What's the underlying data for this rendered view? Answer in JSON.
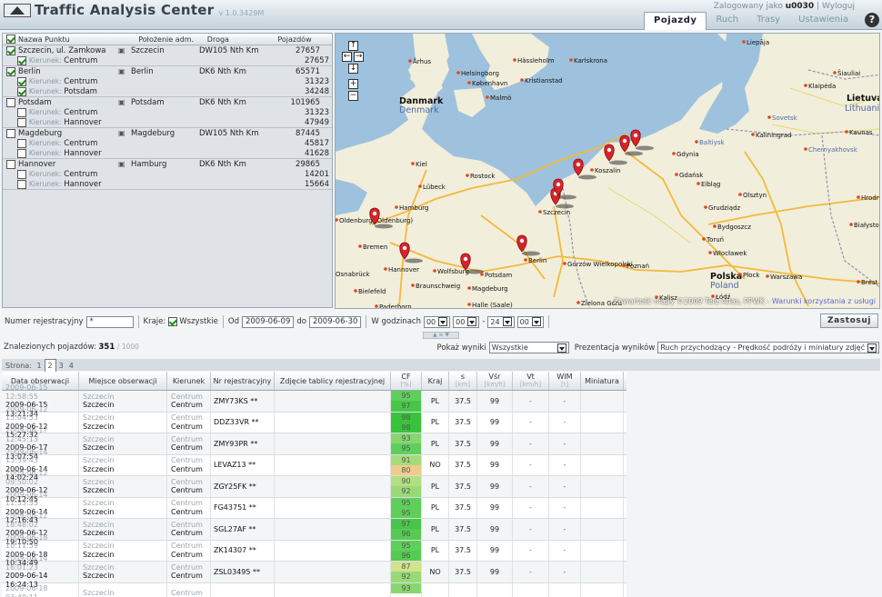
{
  "app": {
    "title": "Traffic Analysis Center",
    "version": "v 1.0.3429M"
  },
  "login": {
    "prefix": "Zalogowany jako",
    "user": "u0030",
    "sep": "|",
    "logout": "Wyloguj",
    "help": "?"
  },
  "tabs": [
    "Pojazdy",
    "Ruch",
    "Trasy",
    "Ustawienia"
  ],
  "points_table": {
    "headers": [
      "Nazwa Punktu",
      "Położenie adm.",
      "Droga",
      "Pojazdów"
    ],
    "kierunek_label": "Kierunek:",
    "groups": [
      {
        "name": "Szczecin, ul. Zamkowa",
        "checked": true,
        "adm": "Szczecin",
        "road": "DW105 Nth Km",
        "count": "27657",
        "subs": [
          {
            "dir": "Centrum",
            "checked": true,
            "count": "27657"
          }
        ]
      },
      {
        "name": "Berlin",
        "checked": true,
        "adm": "Berlin",
        "road": "DK6 Nth Km",
        "count": "65571",
        "subs": [
          {
            "dir": "Centrum",
            "checked": true,
            "count": "31323"
          },
          {
            "dir": "Potsdam",
            "checked": true,
            "count": "34248"
          }
        ]
      },
      {
        "name": "Potsdam",
        "checked": false,
        "adm": "Potsdam",
        "road": "DK6 Nth Km",
        "count": "101965",
        "subs": [
          {
            "dir": "Centrum",
            "checked": false,
            "count": "31323"
          },
          {
            "dir": "Hannover",
            "checked": false,
            "count": "47949"
          }
        ]
      },
      {
        "name": "Magdeburg",
        "checked": false,
        "adm": "Magdeburg",
        "road": "DW105 Nth Km",
        "count": "87445",
        "subs": [
          {
            "dir": "Centrum",
            "checked": false,
            "count": "45817"
          },
          {
            "dir": "Hannover",
            "checked": false,
            "count": "41628"
          }
        ]
      },
      {
        "name": "Hannover",
        "checked": false,
        "adm": "Hamburg",
        "road": "DK6 Nth Km",
        "count": "29865",
        "subs": [
          {
            "dir": "Centrum",
            "checked": false,
            "count": "14201"
          },
          {
            "dir": "Hannover",
            "checked": false,
            "count": "15664"
          }
        ]
      }
    ]
  },
  "map": {
    "cities": [
      {
        "name": "Liepāja"
      },
      {
        "name": "Århus"
      },
      {
        "name": "Hässleholm"
      },
      {
        "name": "Karlskrona"
      },
      {
        "name": "Helsingborg"
      },
      {
        "name": "København"
      },
      {
        "name": "Kristianstad"
      },
      {
        "name": "Malmö"
      },
      {
        "name": "Šiauliai"
      },
      {
        "name": "Klaipėda"
      },
      {
        "name": "Danmark"
      },
      {
        "name": "Denmark"
      },
      {
        "name": "Lietuva"
      },
      {
        "name": "Lithuania"
      },
      {
        "name": "Sovetsk"
      },
      {
        "name": "Kaunas"
      },
      {
        "name": "Kaliningrad"
      },
      {
        "name": "Baltiysk"
      },
      {
        "name": "Chernyakhovsk"
      },
      {
        "name": "Gdynia"
      },
      {
        "name": "Gdańsk"
      },
      {
        "name": "Elbląg"
      },
      {
        "name": "Olsztyn"
      },
      {
        "name": "Koszalin"
      },
      {
        "name": "Kiel"
      },
      {
        "name": "Rostock"
      },
      {
        "name": "Lübeck"
      },
      {
        "name": "Hamburg"
      },
      {
        "name": "Oldenburg (Oldenburg)"
      },
      {
        "name": "Bremen"
      },
      {
        "name": "Szczecin"
      },
      {
        "name": "Grudziądz"
      },
      {
        "name": "Bydgoszcz"
      },
      {
        "name": "Toruń"
      },
      {
        "name": "Włocławek"
      },
      {
        "name": "Gorzów Wielkopolski"
      },
      {
        "name": "Poznań"
      },
      {
        "name": "Polska"
      },
      {
        "name": "Poland"
      },
      {
        "name": "Płock"
      },
      {
        "name": "Warszawa"
      },
      {
        "name": "Hrodna"
      },
      {
        "name": "Białystok"
      },
      {
        "name": "Brest"
      },
      {
        "name": "Osnabrück"
      },
      {
        "name": "Hannover"
      },
      {
        "name": "Wolfsburg"
      },
      {
        "name": "Potsdam"
      },
      {
        "name": "Berlin"
      },
      {
        "name": "Braunschweig"
      },
      {
        "name": "Magdeburg"
      },
      {
        "name": "Bielefeld"
      },
      {
        "name": "Paderborn"
      },
      {
        "name": "Halle (Saale)"
      },
      {
        "name": "Zielona Góra"
      },
      {
        "name": "Kalisz"
      },
      {
        "name": "Łódź"
      }
    ],
    "controls": [
      "↑",
      "←",
      "→",
      "↓",
      "+",
      "−"
    ],
    "copyright": "Zawartość mapy ©2009 Tele Atlas, PPWK -",
    "terms": "Warunki korzystania z usługi"
  },
  "filter": {
    "plate_label": "Numer rejestracyjny",
    "plate_value": "*",
    "country_label": "Kraje:",
    "country_all": "Wszystkie",
    "from_label": "Od",
    "from_date": "2009-06-09",
    "to_label": "do",
    "to_date": "2009-06-30",
    "hours_label": "W godzinach",
    "h1": "00",
    "h2": "00",
    "h_sep": "-",
    "h3": "24",
    "h4": "00",
    "apply": "Zastosuj"
  },
  "results": {
    "found_label": "Znalezionych pojazdów:",
    "found": "351",
    "total": "/ 1000",
    "show_label": "Pokaż wyniki",
    "show_value": "Wszystkie",
    "present_label": "Prezentacja wyników",
    "present_value": "Ruch przychodzący - Prędkość podróży i miniatury zdjęć"
  },
  "pager": {
    "label": "Strona:",
    "pages": [
      "1",
      "2",
      "3",
      "4"
    ],
    "current": "2"
  },
  "vehicle_table": {
    "headers": [
      {
        "t": "Data obserwacji",
        "u": ""
      },
      {
        "t": "Miejsce obserwacji",
        "u": ""
      },
      {
        "t": "Kierunek",
        "u": ""
      },
      {
        "t": "Nr rejestracyjny",
        "u": ""
      },
      {
        "t": "Zdjęcie tablicy rejestracyjnej",
        "u": ""
      },
      {
        "t": "CF",
        "u": "[%]"
      },
      {
        "t": "Kraj",
        "u": ""
      },
      {
        "t": "s",
        "u": "[km]"
      },
      {
        "t": "Vśr",
        "u": "[km/h]"
      },
      {
        "t": "Vt",
        "u": "[km/h]"
      },
      {
        "t": "WIM",
        "u": "[t]"
      },
      {
        "t": "Miniatura",
        "u": ""
      }
    ],
    "rows": [
      {
        "d1": "2009-06-15  12:58:55",
        "d2": "2009-06-15  13:21:34",
        "p1": "Szczecin",
        "p2": "Szczecin",
        "k1": "Centrum",
        "k2": "Centrum",
        "nr": "ZMY73KS **",
        "cf1": "95",
        "cf2": "97",
        "c1": "#5fcf5c",
        "c2": "#49c649",
        "kraj": "PL",
        "s": "37.5",
        "v": "99",
        "vt": "-",
        "wim": "-"
      },
      {
        "d1": "2009-06-12  15:04:53",
        "d2": "2009-06-12  15:27:32",
        "p1": "Szczecin",
        "p2": "Szczecin",
        "k1": "Centrum",
        "k2": "Centrum",
        "nr": "DDZ33VR **",
        "cf1": "98",
        "cf2": "98",
        "c1": "#39c23c",
        "c2": "#39c23c",
        "kraj": "PL",
        "s": "37.5",
        "v": "99",
        "vt": "-",
        "wim": "-"
      },
      {
        "d1": "2009-06-17  12:45:13",
        "d2": "2009-06-17  13:07:54",
        "p1": "Szczecin",
        "p2": "Szczecin",
        "k1": "Centrum",
        "k2": "Centrum",
        "nr": "ZMY93PR **",
        "cf1": "93",
        "cf2": "95",
        "c1": "#87d66f",
        "c2": "#5fcf5c",
        "kraj": "PL",
        "s": "37.5",
        "v": "99",
        "vt": "-",
        "wim": "-"
      },
      {
        "d1": "2009-06-14  13:39:43",
        "d2": "2009-06-14  14:02:24",
        "p1": "Szczecin",
        "p2": "Szczecin",
        "k1": "Centrum",
        "k2": "Centrum",
        "nr": "LEVAZ13 **",
        "cf1": "91",
        "cf2": "80",
        "c1": "#a5dc7b",
        "c2": "#f0cc8a",
        "kraj": "NO",
        "s": "37.5",
        "v": "99",
        "vt": "-",
        "wim": "-"
      },
      {
        "d1": "2009-06-12  09:50:02",
        "d2": "2009-06-12  10:12:45",
        "p1": "Szczecin",
        "p2": "Szczecin",
        "k1": "Centrum",
        "k2": "Centrum",
        "nr": "ZGY25FK **",
        "cf1": "90",
        "cf2": "92",
        "c1": "#b4df80",
        "c2": "#99d977",
        "kraj": "PL",
        "s": "37.5",
        "v": "99",
        "vt": "-",
        "wim": "-"
      },
      {
        "d1": "2009-06-14  11:53:55",
        "d2": "2009-06-14  12:16:43",
        "p1": "Szczecin",
        "p2": "Szczecin",
        "k1": "Centrum",
        "k2": "Centrum",
        "nr": "FG43751 **",
        "cf1": "95",
        "cf2": "95",
        "c1": "#5fcf5c",
        "c2": "#5fcf5c",
        "kraj": "PL",
        "s": "37.5",
        "v": "99",
        "vt": "-",
        "wim": "-"
      },
      {
        "d1": "2009-06-12  18:48:02",
        "d2": "2009-06-12  19:10:50",
        "p1": "Szczecin",
        "p2": "Szczecin",
        "k1": "Centrum",
        "k2": "Centrum",
        "nr": "SGL27AF **",
        "cf1": "97",
        "cf2": "96",
        "c1": "#49c649",
        "c2": "#55cb52",
        "kraj": "PL",
        "s": "37.5",
        "v": "99",
        "vt": "-",
        "wim": "-"
      },
      {
        "d1": "2009-06-18  10:11:59",
        "d2": "2009-06-18  10:34:49",
        "p1": "Szczecin",
        "p2": "Szczecin",
        "k1": "Centrum",
        "k2": "Centrum",
        "nr": "ZK14307 **",
        "cf1": "95",
        "cf2": "96",
        "c1": "#5fcf5c",
        "c2": "#55cb52",
        "kraj": "PL",
        "s": "37.5",
        "v": "99",
        "vt": "-",
        "wim": "-"
      },
      {
        "d1": "2009-06-14  16:01:23",
        "d2": "2009-06-14  16:24:13",
        "p1": "Szczecin",
        "p2": "Szczecin",
        "k1": "Centrum",
        "k2": "Centrum",
        "nr": "ZSL03495 **",
        "cf1": "87",
        "cf2": "92",
        "c1": "#d2e38b",
        "c2": "#99d977",
        "kraj": "NO",
        "s": "37.5",
        "v": "99",
        "vt": "-",
        "wim": "-"
      },
      {
        "d1": "2009-06-18  03:49:11",
        "d2": "",
        "p1": "Szczecin",
        "p2": "",
        "k1": "Centrum",
        "k2": "",
        "nr": "",
        "cf1": "93",
        "cf2": "",
        "c1": "#87d66f",
        "c2": "#ffffff",
        "kraj": "",
        "s": "",
        "v": "",
        "vt": "",
        "wim": ""
      }
    ]
  }
}
